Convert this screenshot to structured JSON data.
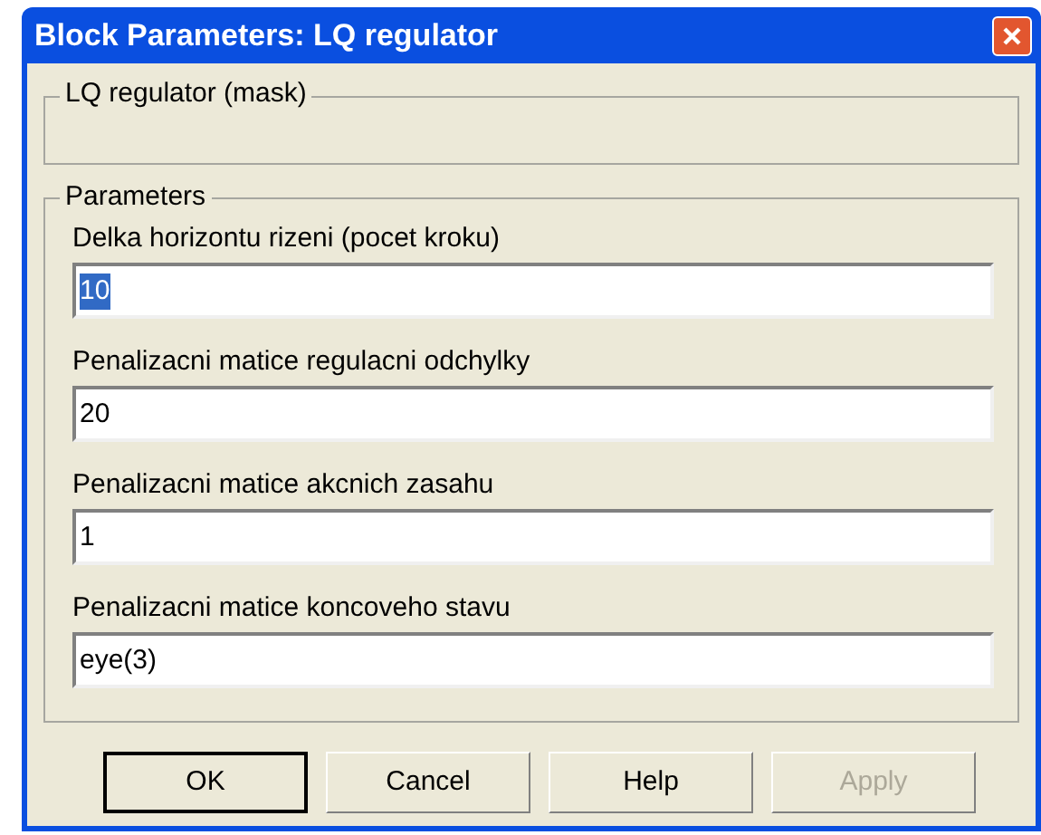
{
  "window": {
    "title": "Block Parameters: LQ regulator"
  },
  "description_group": {
    "title": "LQ regulator (mask)"
  },
  "parameters_group": {
    "title": "Parameters",
    "fields": [
      {
        "label": "Delka horizontu rizeni (pocet kroku)",
        "value": "10",
        "selected": true
      },
      {
        "label": "Penalizacni matice regulacni odchylky",
        "value": "20",
        "selected": false
      },
      {
        "label": "Penalizacni matice akcnich zasahu",
        "value": "1",
        "selected": false
      },
      {
        "label": "Penalizacni matice koncoveho stavu",
        "value": "eye(3)",
        "selected": false
      }
    ]
  },
  "buttons": [
    {
      "label": "OK",
      "default": true,
      "disabled": false
    },
    {
      "label": "Cancel",
      "default": false,
      "disabled": false
    },
    {
      "label": "Help",
      "default": false,
      "disabled": false
    },
    {
      "label": "Apply",
      "default": false,
      "disabled": true
    }
  ]
}
